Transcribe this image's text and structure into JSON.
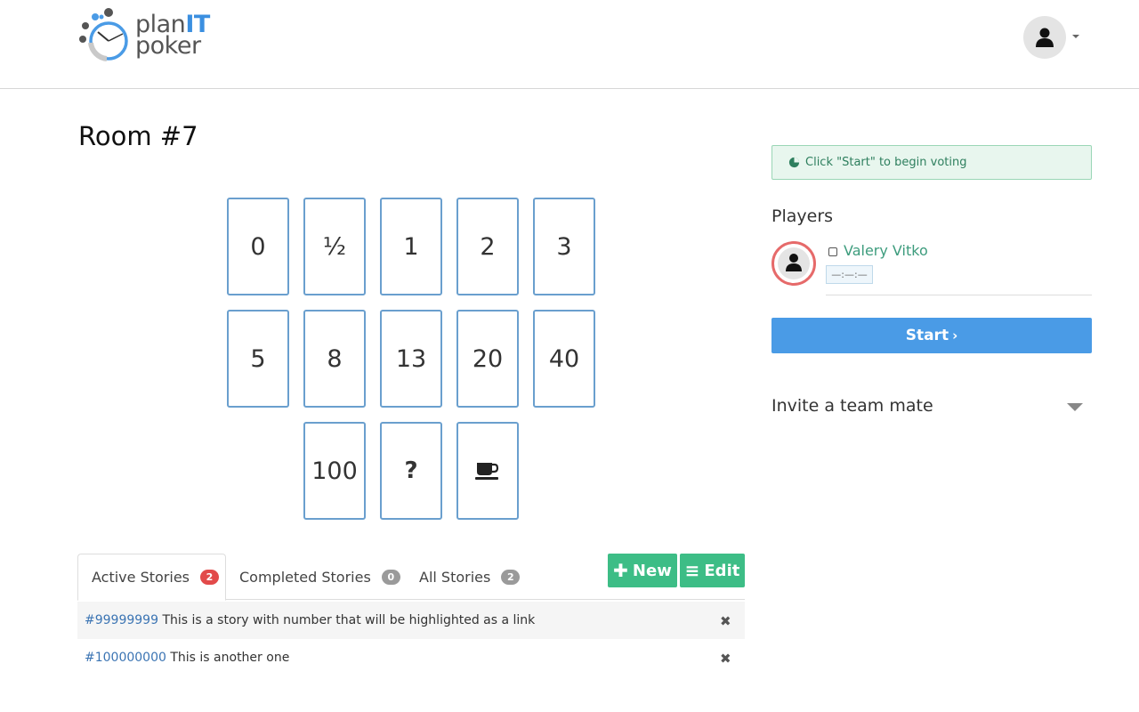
{
  "app": {
    "logo_word1": "plan",
    "logo_word1_accent": "IT",
    "logo_word2": "poker"
  },
  "header": {
    "user_avatar_icon": "user-icon",
    "menu_icon": "caret-down-icon"
  },
  "room": {
    "title": "Room #7"
  },
  "cards": [
    "0",
    "½",
    "1",
    "2",
    "3",
    "5",
    "8",
    "13",
    "20",
    "40",
    "100",
    "?",
    "coffee-icon"
  ],
  "stories_tabs": [
    {
      "label": "Active Stories",
      "count": "2"
    },
    {
      "label": "Completed Stories",
      "count": "0"
    },
    {
      "label": "All Stories",
      "count": "2"
    }
  ],
  "actions": {
    "new_label": "New",
    "edit_label": "Edit"
  },
  "stories": [
    {
      "number": "#99999999",
      "text": "This is a story with number that will be highlighted as a link"
    },
    {
      "number": "#100000000",
      "text": "This is another one"
    }
  ],
  "status": {
    "message": "Click \"Start\" to begin voting"
  },
  "players": {
    "title": "Players",
    "list": [
      {
        "name": "Valery Vitko",
        "vote": "—:—:—"
      }
    ]
  },
  "start_button": {
    "label": "Start"
  },
  "invite": {
    "label": "Invite a team mate"
  },
  "colors": {
    "accent_blue": "#4a9be6",
    "green": "#3dbd86",
    "red_badge": "#e24a4a",
    "card_border": "#6a9fce"
  }
}
